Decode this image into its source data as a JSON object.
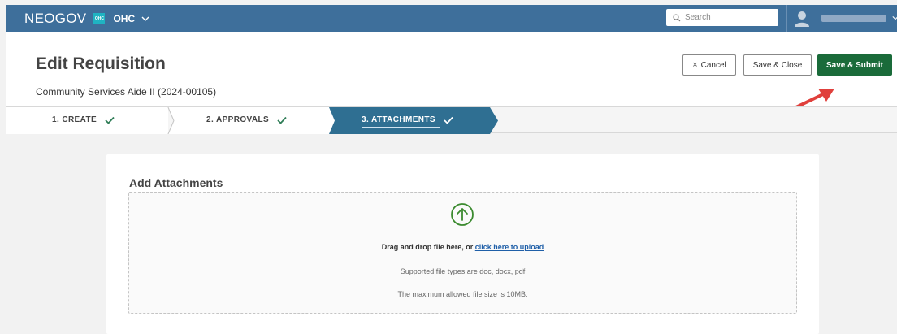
{
  "topbar": {
    "brand": "NEOGOV",
    "logo_text": "OHC",
    "org": "OHC",
    "search_placeholder": "Search",
    "colors": {
      "bar": "#3e6f9b",
      "logo": "#1fb3c2"
    }
  },
  "header": {
    "title": "Edit Requisition",
    "subtitle": "Community Services Aide II (2024-00105)",
    "buttons": {
      "cancel_icon": "×",
      "cancel": "Cancel",
      "save_close": "Save & Close",
      "save_submit": "Save & Submit"
    },
    "colors": {
      "submit": "#1a6b3a",
      "annotation_arrow": "#e0403c"
    }
  },
  "steps": [
    {
      "label": "1. CREATE",
      "state": "complete"
    },
    {
      "label": "2. APPROVALS",
      "state": "complete"
    },
    {
      "label": "3. ATTACHMENTS",
      "state": "active"
    }
  ],
  "steps_colors": {
    "active": "#2f6f92"
  },
  "attachments": {
    "title": "Add Attachments",
    "upload_icon": "arrow-up-circle-icon",
    "drag_text": "Drag and drop file here, or ",
    "upload_link": "click here to upload",
    "types_text": "Supported file types are doc, docx, pdf",
    "size_text": "The maximum allowed file size is 10MB."
  }
}
